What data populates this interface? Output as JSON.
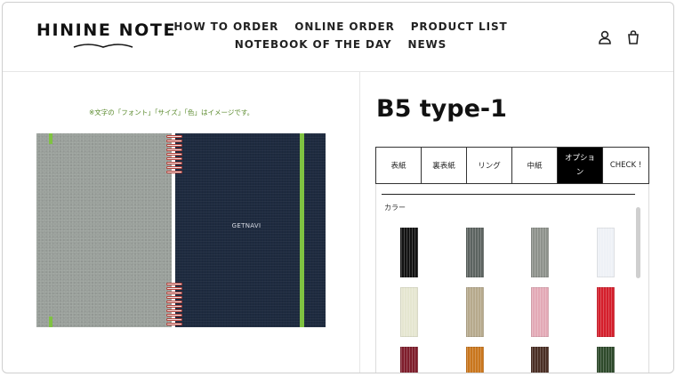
{
  "header": {
    "logo_text": "HININE NOTE",
    "nav_row1": [
      "HOW TO ORDER",
      "ONLINE ORDER",
      "PRODUCT LIST"
    ],
    "nav_row2": [
      "NOTEBOOK OF THE DAY",
      "NEWS"
    ],
    "icons": [
      "account-icon",
      "cart-icon"
    ]
  },
  "preview": {
    "note": "※文字の「フォント」「サイズ」「色」はイメージです。",
    "cover_label": "GETNAVI"
  },
  "product": {
    "title": "B5 type-1",
    "tabs": [
      "表紙",
      "裏表紙",
      "リング",
      "中紙",
      "オプション",
      "CHECK !"
    ],
    "active_tab": "オプション",
    "option_section_label": "カラー",
    "band_colors": [
      "#111111",
      "#5c6360",
      "#8d918b",
      "#eef1f6",
      "#e5e6d0",
      "#b6a98c",
      "#e3a9b6",
      "#d41f2c",
      "#7e1d2b",
      "#c9761d",
      "#4a2e24",
      "#2e4a2b"
    ]
  },
  "colors": {
    "accent_green": "#7fc241",
    "cover_navy": "#1e2b40",
    "cover_grey": "#9aa09b",
    "ring_red": "#b5423a"
  }
}
